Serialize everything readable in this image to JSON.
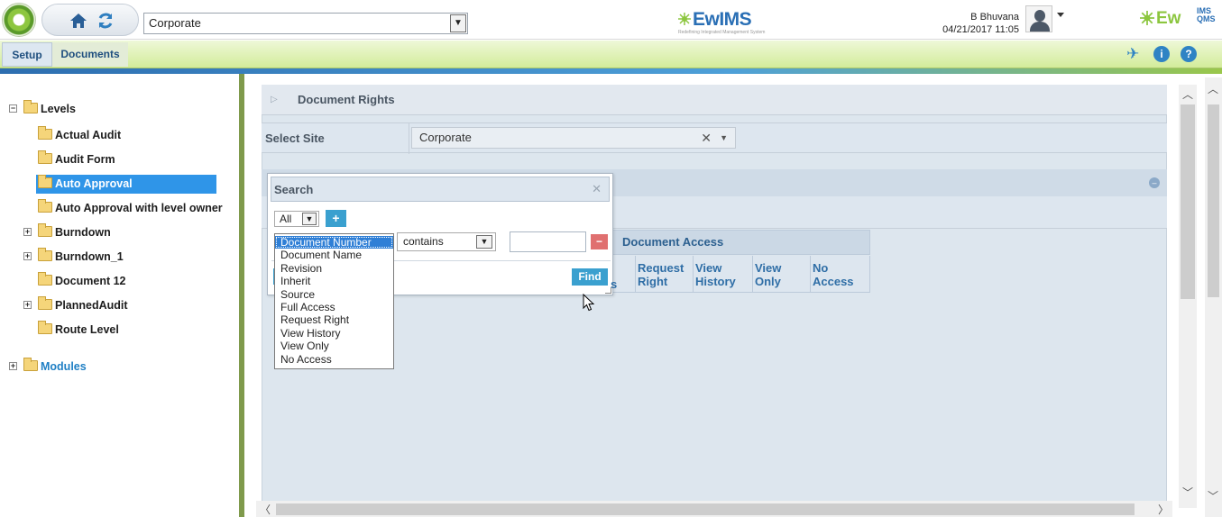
{
  "header": {
    "site_value": "Corporate",
    "brand_name": "EwIMS",
    "brand_tagline": "Redefining Integrated Management System",
    "brand2_name": "Ew",
    "brand2_sup": "IMS QMS",
    "user_name": "B Bhuvana",
    "datetime": "04/21/2017 11:05"
  },
  "menu": {
    "setup": "Setup",
    "documents": "Documents"
  },
  "tree": {
    "root": "Levels",
    "items": [
      {
        "label": "Actual Audit"
      },
      {
        "label": "Audit Form"
      },
      {
        "label": "Auto Approval"
      },
      {
        "label": "Auto Approval with level owner"
      },
      {
        "label": "Burndown"
      },
      {
        "label": "Burndown_1"
      },
      {
        "label": "Document 12"
      },
      {
        "label": "PlannedAudit"
      },
      {
        "label": "Route Level"
      }
    ],
    "modules": "Modules"
  },
  "panel": {
    "title": "Document Rights",
    "select_site_label": "Select Site",
    "select_site_value": "Corporate",
    "document_access_header": "Document Access",
    "columns": [
      "Request Right",
      "View History",
      "View Only",
      "No Access"
    ]
  },
  "search": {
    "title": "Search",
    "scope_value": "All",
    "operator_value": "contains",
    "find_label": "Find",
    "field_options": [
      "Document Number",
      "Document Name",
      "Revision",
      "Inherit",
      "Source",
      "Full Access",
      "Request Right",
      "View History",
      "View Only",
      "No Access"
    ],
    "selected_index": 0
  },
  "colors": {
    "accent": "#3aa0cf",
    "selection": "#2f95e8",
    "brand_green": "#8cc63f"
  }
}
